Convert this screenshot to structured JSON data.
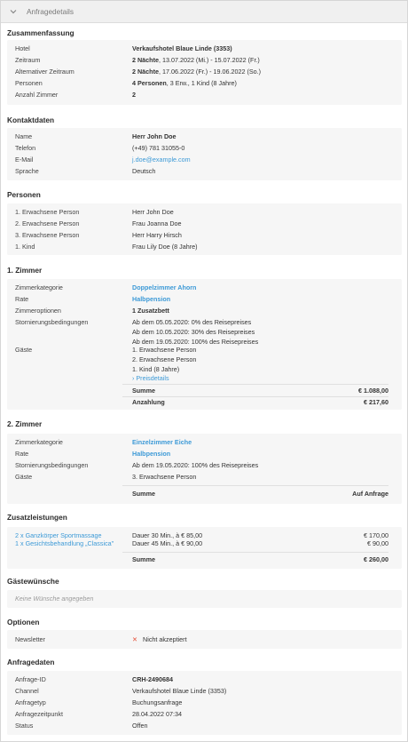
{
  "header": {
    "title": "Anfragedetails"
  },
  "summary": {
    "title": "Zusammenfassung",
    "hotel_label": "Hotel",
    "hotel_value": "Verkaufshotel Blaue Linde (3353)",
    "period_label": "Zeitraum",
    "period_nights": "2 Nächte",
    "period_dates": ", 13.07.2022 (Mi.) - 15.07.2022 (Fr.)",
    "alt_period_label": "Alternativer Zeitraum",
    "alt_period_nights": "2 Nächte",
    "alt_period_dates": ", 17.06.2022 (Fr.) - 19.06.2022 (So.)",
    "persons_label": "Personen",
    "persons_bold": "4 Personen",
    "persons_rest": ", 3 Erw., 1 Kind (8 Jahre)",
    "rooms_label": "Anzahl Zimmer",
    "rooms_value": "2"
  },
  "contact": {
    "title": "Kontaktdaten",
    "name_label": "Name",
    "name_value": "Herr John Doe",
    "phone_label": "Telefon",
    "phone_value": "(+49) 781 31055-0",
    "email_label": "E-Mail",
    "email_value": "j.doe@example.com",
    "lang_label": "Sprache",
    "lang_value": "Deutsch"
  },
  "persons": {
    "title": "Personen",
    "items": [
      {
        "label": "1. Erwachsene Person",
        "value": "Herr John Doe"
      },
      {
        "label": "2. Erwachsene Person",
        "value": "Frau Joanna Doe"
      },
      {
        "label": "3. Erwachsene Person",
        "value": "Herr Harry Hirsch"
      },
      {
        "label": "1. Kind",
        "value": "Frau Lily Doe (8 Jahre)"
      }
    ]
  },
  "room1": {
    "title": "1. Zimmer",
    "category_label": "Zimmerkategorie",
    "category_value": "Doppelzimmer Ahorn",
    "rate_label": "Rate",
    "rate_value": "Halbpension",
    "options_label": "Zimmeroptionen",
    "options_value": "1 Zusatzbett",
    "cancel_label": "Stornierungsbedingungen",
    "cancel_lines": [
      "Ab dem 05.05.2020: 0% des Reisepreises",
      "Ab dem 10.05.2020: 30% des Reisepreises",
      "Ab dem 19.05.2020: 100% des Reisepreises"
    ],
    "guests_label": "Gäste",
    "guests_lines": [
      "1. Erwachsene Person",
      "2. Erwachsene Person",
      "1. Kind (8 Jahre)"
    ],
    "price_details": "Preisdetails",
    "sum_label": "Summe",
    "sum_value": "€ 1.088,00",
    "deposit_label": "Anzahlung",
    "deposit_value": "€ 217,60"
  },
  "room2": {
    "title": "2. Zimmer",
    "category_label": "Zimmerkategorie",
    "category_value": "Einzelzimmer Eiche",
    "rate_label": "Rate",
    "rate_value": "Halbpension",
    "cancel_label": "Stornierungsbedingungen",
    "cancel_value": "Ab dem 19.05.2020: 100% des Reisepreises",
    "guests_label": "Gäste",
    "guests_value": "3. Erwachsene Person",
    "sum_label": "Summe",
    "sum_value": "Auf Anfrage"
  },
  "extras": {
    "title": "Zusatzleistungen",
    "items": [
      {
        "name": "2 x Ganzkörper Sportmassage",
        "detail": "Dauer 30 Min., à € 85,00",
        "price": "€ 170,00"
      },
      {
        "name": "1 x Gesichtsbehandlung „Classica\"",
        "detail": "Dauer 45 Min., à € 90,00",
        "price": "€ 90,00"
      }
    ],
    "sum_label": "Summe",
    "sum_value": "€ 260,00"
  },
  "wishes": {
    "title": "Gästewünsche",
    "value": "Keine Wünsche angegeben"
  },
  "options": {
    "title": "Optionen",
    "newsletter_label": "Newsletter",
    "newsletter_value": "Nicht akzeptiert"
  },
  "request": {
    "title": "Anfragedaten",
    "id_label": "Anfrage-ID",
    "id_value": "CRH-2490684",
    "channel_label": "Channel",
    "channel_value": "Verkaufshotel Blaue Linde (3353)",
    "type_label": "Anfragetyp",
    "type_value": "Buchungsanfrage",
    "time_label": "Anfragezeitpunkt",
    "time_value": "28.04.2022 07:34",
    "status_label": "Status",
    "status_value": "Offen"
  },
  "colors": {
    "link": "#3d9ad7",
    "card_bg": "#f6f6f6",
    "header_bg": "#f0f0f0",
    "error": "#e5533c"
  }
}
